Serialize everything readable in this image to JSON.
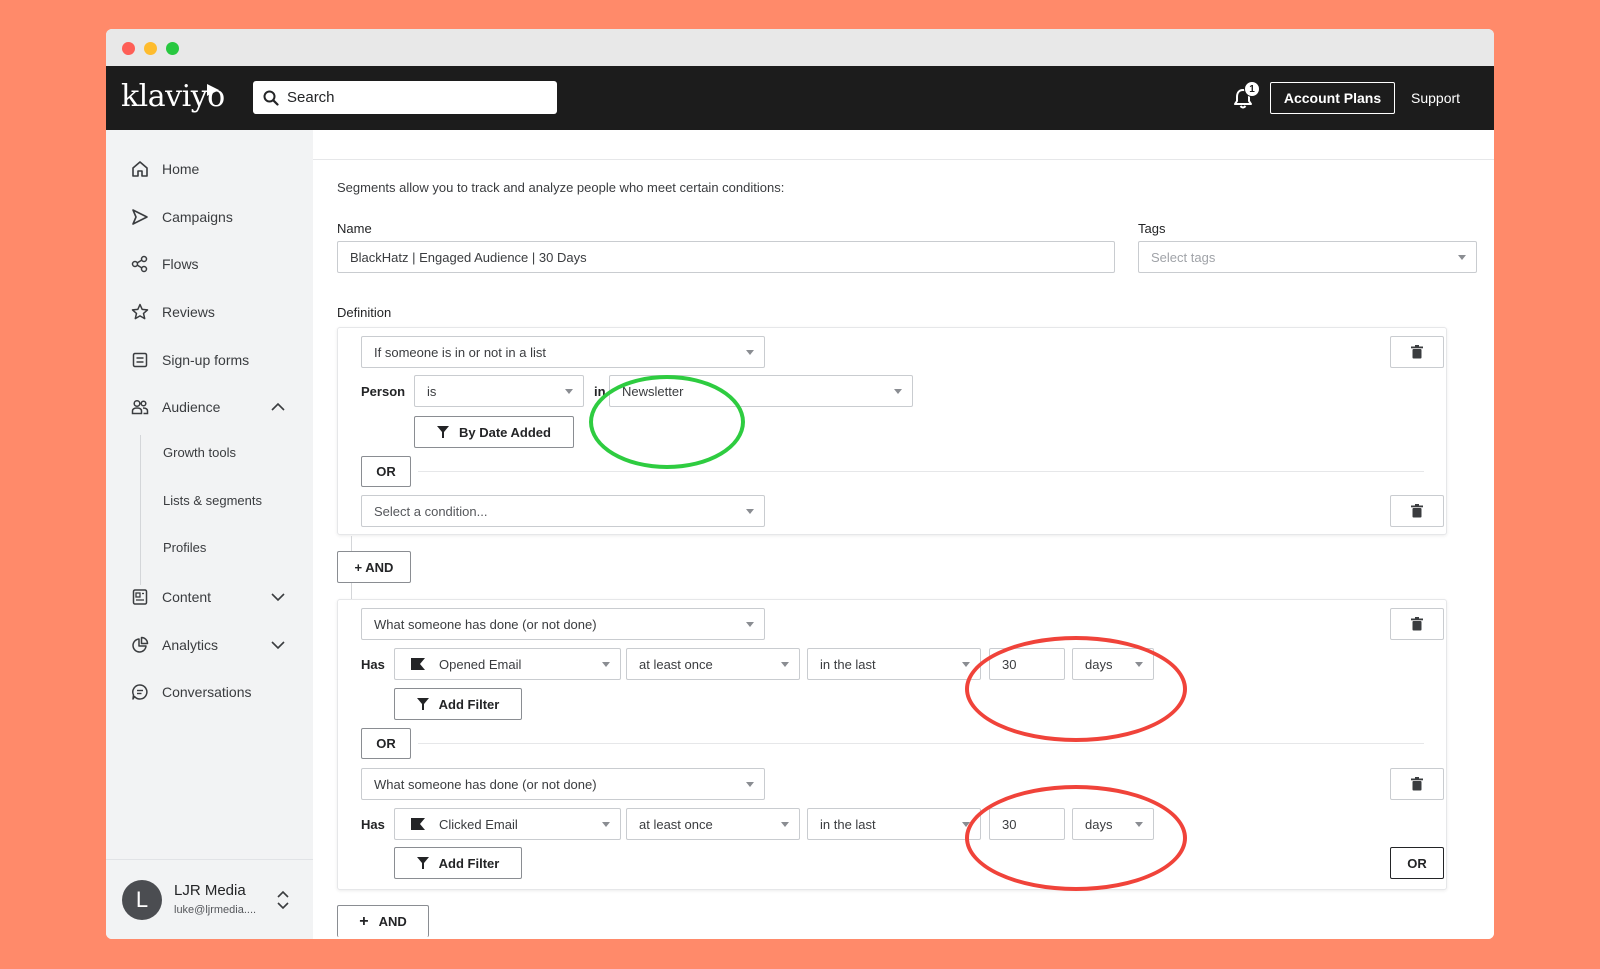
{
  "app": {
    "logo_text": "klaviyo"
  },
  "topbar": {
    "search_placeholder": "Search",
    "notification_count": "1",
    "account_plans_label": "Account Plans",
    "support_label": "Support"
  },
  "sidebar": {
    "items": [
      {
        "label": "Home",
        "icon": "home-icon"
      },
      {
        "label": "Campaigns",
        "icon": "send-icon"
      },
      {
        "label": "Flows",
        "icon": "flows-icon"
      },
      {
        "label": "Reviews",
        "icon": "star-icon"
      },
      {
        "label": "Sign-up forms",
        "icon": "form-icon"
      },
      {
        "label": "Audience",
        "icon": "people-icon"
      },
      {
        "label": "Content",
        "icon": "content-icon"
      },
      {
        "label": "Analytics",
        "icon": "pie-chart-icon"
      },
      {
        "label": "Conversations",
        "icon": "chat-icon"
      }
    ],
    "audience_subitems": [
      "Growth tools",
      "Lists & segments",
      "Profiles"
    ],
    "user": {
      "initial": "L",
      "name": "LJR Media",
      "email": "luke@ljrmedia...."
    }
  },
  "form": {
    "intro": "Segments allow you to track and analyze people who meet certain conditions:",
    "name_label": "Name",
    "name_value": "BlackHatz | Engaged Audience | 30 Days",
    "tags_label": "Tags",
    "tags_placeholder": "Select tags",
    "definition_label": "Definition"
  },
  "block1": {
    "condition_type": "If someone is in or not in a list",
    "row_label": "Person",
    "operator": "is",
    "in_label": "in",
    "list_value": "Newsletter",
    "filter_button": "By Date Added",
    "or_label": "OR",
    "second_condition_placeholder": "Select a condition..."
  },
  "and_button_1": "+ AND",
  "block2": {
    "cond1": {
      "condition_type": "What someone has done (or not done)",
      "row_label": "Has",
      "metric": "Opened Email",
      "frequency": "at least once",
      "timeframe": "in the last",
      "amount": "30",
      "unit": "days",
      "filter_button": "Add Filter"
    },
    "or_label": "OR",
    "cond2": {
      "condition_type": "What someone has done (or not done)",
      "row_label": "Has",
      "metric": "Clicked Email",
      "frequency": "at least once",
      "timeframe": "in the last",
      "amount": "30",
      "unit": "days",
      "filter_button": "Add Filter"
    },
    "or_button": "OR"
  },
  "and_button_2": "AND"
}
